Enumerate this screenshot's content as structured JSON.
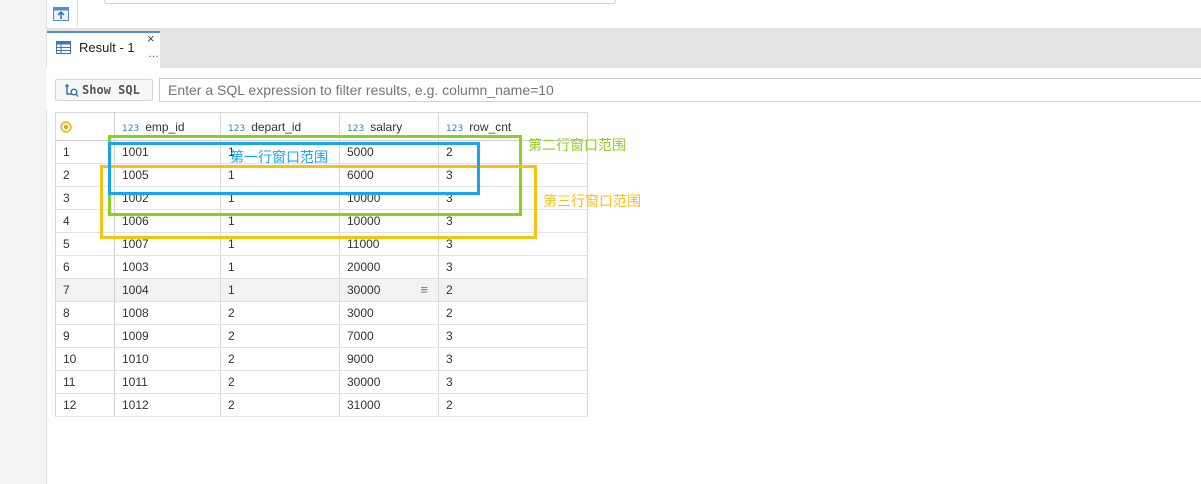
{
  "tab": {
    "label": "Result - 1",
    "close": "×",
    "more": "…"
  },
  "filter": {
    "show_sql_label": "Show SQL",
    "placeholder": "Enter a SQL expression to filter results, e.g. column_name=10"
  },
  "grid": {
    "type_badge": "123",
    "columns": [
      "emp_id",
      "depart_id",
      "salary",
      "row_cnt"
    ],
    "rows": [
      {
        "n": "1",
        "emp_id": "1001",
        "depart_id": "1",
        "salary": "5000",
        "row_cnt": "2"
      },
      {
        "n": "2",
        "emp_id": "1005",
        "depart_id": "1",
        "salary": "6000",
        "row_cnt": "3"
      },
      {
        "n": "3",
        "emp_id": "1002",
        "depart_id": "1",
        "salary": "10000",
        "row_cnt": "3"
      },
      {
        "n": "4",
        "emp_id": "1006",
        "depart_id": "1",
        "salary": "10000",
        "row_cnt": "3"
      },
      {
        "n": "5",
        "emp_id": "1007",
        "depart_id": "1",
        "salary": "11000",
        "row_cnt": "3"
      },
      {
        "n": "6",
        "emp_id": "1003",
        "depart_id": "1",
        "salary": "20000",
        "row_cnt": "3"
      },
      {
        "n": "7",
        "emp_id": "1004",
        "depart_id": "1",
        "salary": "30000",
        "row_cnt": "2"
      },
      {
        "n": "8",
        "emp_id": "1008",
        "depart_id": "2",
        "salary": "3000",
        "row_cnt": "2"
      },
      {
        "n": "9",
        "emp_id": "1009",
        "depart_id": "2",
        "salary": "7000",
        "row_cnt": "3"
      },
      {
        "n": "10",
        "emp_id": "1010",
        "depart_id": "2",
        "salary": "9000",
        "row_cnt": "3"
      },
      {
        "n": "11",
        "emp_id": "1011",
        "depart_id": "2",
        "salary": "30000",
        "row_cnt": "3"
      },
      {
        "n": "12",
        "emp_id": "1012",
        "depart_id": "2",
        "salary": "31000",
        "row_cnt": "2"
      }
    ]
  },
  "annotations": {
    "first_row_window": "第一行窗口范围",
    "second_row_window": "第二行窗口范围",
    "third_row_window": "第三行窗口范围",
    "colors": {
      "blue": "#1aa3f2",
      "green": "#8fce1d",
      "yellow": "#f6c215"
    }
  },
  "icons": {
    "top": "upload-panel-icon",
    "tab": "table-grid-icon",
    "show_sql": "sql-search-icon",
    "row_selector": "select-all-icon",
    "row_menu": "hamburger-menu-icon"
  }
}
